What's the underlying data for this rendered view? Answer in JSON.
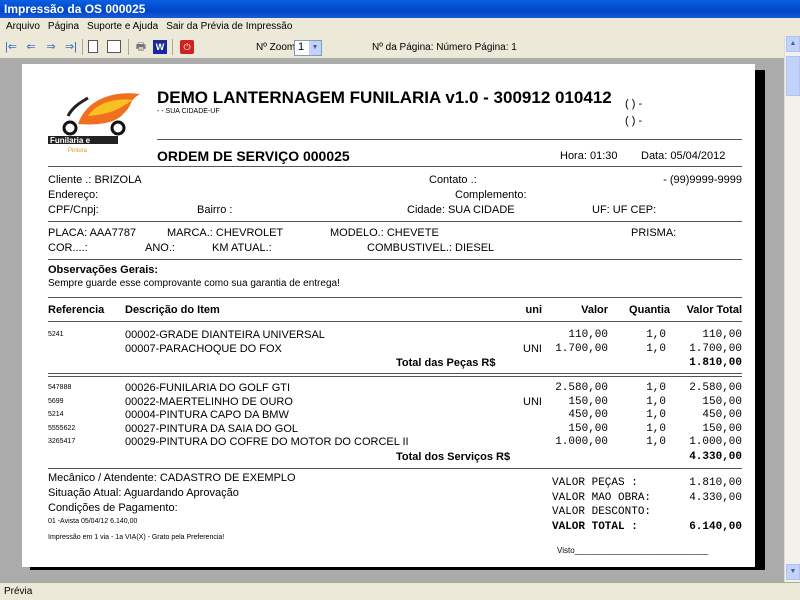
{
  "window": {
    "title": "Impressão da OS 000025"
  },
  "menu": [
    "Arquivo",
    "Página",
    "Suporte e Ajuda",
    "Sair da Prévia de Impressão"
  ],
  "toolbar": {
    "zoom_label": "Nº Zoom",
    "zoom_value": "1",
    "page_info": "Nº da Página: Número Página: 1"
  },
  "header": {
    "company": "DEMO LANTERNAGEM FUNILARIA v1.0 - 300912 010412",
    "city": "- - SUA CIDADE-UF",
    "phone1": "(   )     -",
    "phone2": "(   )     -",
    "logo_text": "Funilaria e Pintura",
    "os_title": "ORDEM DE SERVIÇO 000025",
    "hora": "Hora: 01:30",
    "data": "Data: 05/04/2012"
  },
  "client": {
    "cliente": "Cliente   .: BRIZOLA",
    "contato": "Contato .:",
    "telefone": "- (99)9999-9999",
    "endereco": "Endereço:",
    "complemento": "Complemento:",
    "cpf": "CPF/Cnpj:",
    "bairro": "Bairro :",
    "cidade": "Cidade: SUA CIDADE",
    "uf": "UF: UF  CEP:"
  },
  "vehicle": {
    "placa": "PLACA: AAA7787",
    "marca": "MARCA.: CHEVROLET",
    "modelo": "MODELO.: CHEVETE",
    "prisma": "PRISMA:",
    "cor": "COR....:",
    "ano": "ANO.:",
    "km": "KM ATUAL.:",
    "combustivel": "COMBUSTIVEL.: DIESEL"
  },
  "obs": {
    "title": "Observações Gerais:",
    "text": "Sempre guarde esse comprovante como sua garantia de entrega!"
  },
  "table": {
    "headers": [
      "Referencia",
      "Descrição do Item",
      "uni",
      "Valor",
      "Quantia",
      "Valor Total"
    ],
    "parts": [
      [
        "5241",
        "00002-GRADE DIANTEIRA UNIVERSAL",
        "",
        "110,00",
        "1,0",
        "110,00"
      ],
      [
        "",
        "00007-PARACHOQUE DO FOX",
        "UNI",
        "1.700,00",
        "1,0",
        "1.700,00"
      ]
    ],
    "parts_total_label": "Total das Peças R$",
    "parts_total": "1.810,00",
    "services": [
      [
        "547888",
        "00026-FUNILARIA DO GOLF GTI",
        "",
        "2.580,00",
        "1,0",
        "2.580,00"
      ],
      [
        "5699",
        "00022-MAERTELINHO DE OURO",
        "UNI",
        "150,00",
        "1,0",
        "150,00"
      ],
      [
        "5214",
        "00004-PINTURA CAPO DA BMW",
        "",
        "450,00",
        "1,0",
        "450,00"
      ],
      [
        "5555622",
        "00027-PINTURA DA SAIA DO GOL",
        "",
        "150,00",
        "1,0",
        "150,00"
      ],
      [
        "3265417",
        "00029-PINTURA DO COFRE DO MOTOR DO CORCEL II",
        "",
        "1.000,00",
        "1,0",
        "1.000,00"
      ]
    ],
    "services_total_label": "Total dos Serviços R$",
    "services_total": "4.330,00"
  },
  "footer": {
    "mecanico": "Mecânico / Atendente: CADASTRO DE EXEMPLO",
    "situacao": "Situação Atual: Aguardando Aprovação",
    "condicoes": "Condições de Pagamento:",
    "pagamento": "01 -Avista      05/04/12  6.140,00",
    "impressao": "Impressão em 1 via  -  1a VIA(X) - Grato pela Preferencia!",
    "visto": "Visto______________________________",
    "totals": [
      {
        "label": "VALOR PEÇAS    :",
        "value": "1.810,00"
      },
      {
        "label": "VALOR MAO OBRA:",
        "value": "4.330,00"
      },
      {
        "label": "VALOR DESCONTO:",
        "value": ""
      },
      {
        "label": "VALOR TOTAL    :",
        "value": "6.140,00"
      }
    ]
  },
  "status": "Prévia"
}
